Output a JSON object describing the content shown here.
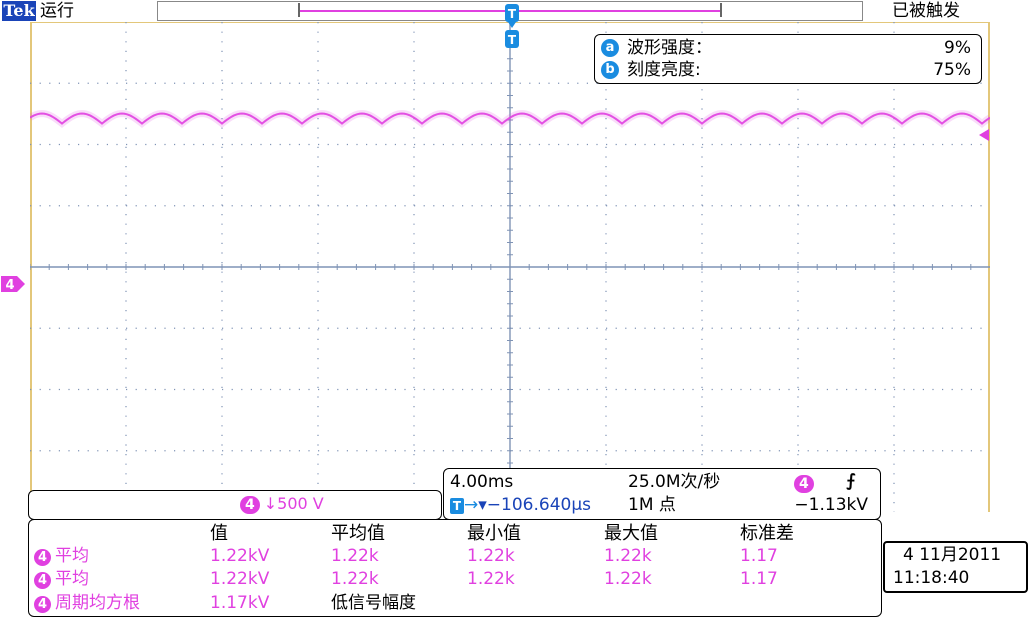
{
  "status_bar": {
    "logo": "Tek",
    "run_state": "运行",
    "trigger_state": "已被触发"
  },
  "intensity": {
    "rows": [
      {
        "badge": "a",
        "label": "波形强度：",
        "value": "9%"
      },
      {
        "badge": "b",
        "label": "刻度亮度:",
        "value": "75%"
      }
    ]
  },
  "channel": {
    "number": "4",
    "scale": "↓500 V",
    "color": "#e040e0"
  },
  "trigger_marker": "T",
  "timebase": {
    "time_per_div": "4.00ms",
    "sample_rate": "25.0M次/秒",
    "trigger_channel": "4",
    "trigger_slope": "⨍",
    "position": "▾−106.640µs",
    "record_length": "1M 点",
    "trigger_level": "−1.13kV"
  },
  "measurements": {
    "headers": [
      "值",
      "平均值",
      "最小值",
      "最大值",
      "标准差"
    ],
    "rows": [
      {
        "channel": "4",
        "name": "平均",
        "values": [
          "1.22kV",
          "1.22k",
          "1.22k",
          "1.22k",
          "1.17"
        ]
      },
      {
        "channel": "4",
        "name": "平均",
        "values": [
          "1.22kV",
          "1.22k",
          "1.22k",
          "1.22k",
          "1.17"
        ]
      },
      {
        "channel": "4",
        "name": "周期均方根",
        "values": [
          "1.17kV",
          "低信号幅度"
        ]
      }
    ]
  },
  "datetime": {
    "date": "4 11月2011",
    "time": "11:18:40"
  },
  "colors": {
    "accent_blue": "#1a8ce0",
    "channel4_magenta": "#e040e0",
    "grid_line": "#7f93b5",
    "border_gold": "#e3c77a"
  }
}
